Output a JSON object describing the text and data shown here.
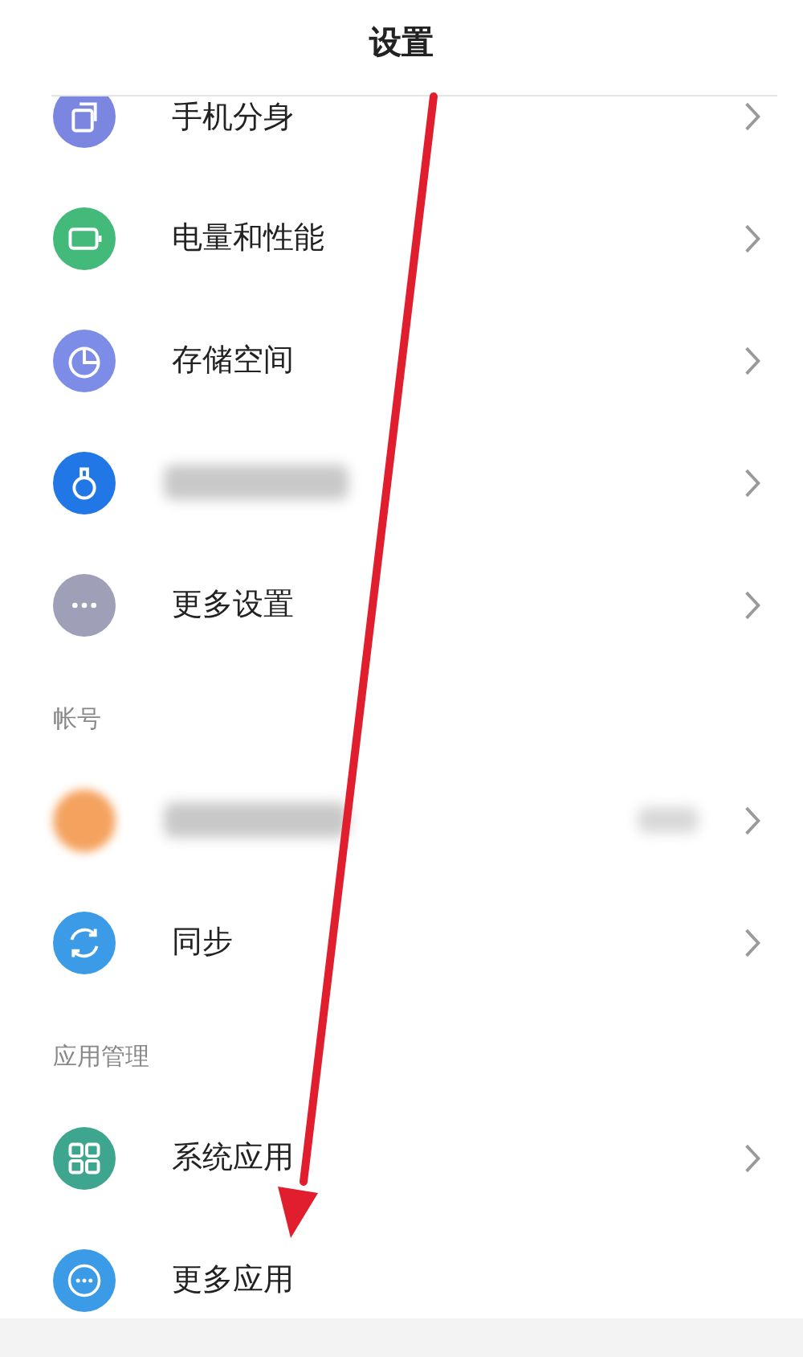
{
  "header": {
    "title": "设置"
  },
  "sections": [
    {
      "items": [
        {
          "kind": "clone",
          "color": "#7b86e0",
          "label": "手机分身",
          "chevron": true
        },
        {
          "kind": "battery",
          "color": "#43b97a",
          "label": "电量和性能",
          "chevron": true
        },
        {
          "kind": "storage",
          "color": "#7d8ce6",
          "label": "存储空间",
          "chevron": true
        },
        {
          "kind": "bottle",
          "color": "#2277e6",
          "blurred": true,
          "chevron": true
        },
        {
          "kind": "dots",
          "color": "#9fa0b8",
          "label": "更多设置",
          "chevron": true
        }
      ]
    },
    {
      "title": "帐号",
      "items": [
        {
          "kind": "avatar",
          "color": "#f4a25e",
          "blurred": true,
          "blurred_value": true,
          "chevron": true
        },
        {
          "kind": "sync",
          "color": "#3b9be6",
          "label": "同步",
          "chevron": true
        }
      ]
    },
    {
      "title": "应用管理",
      "items": [
        {
          "kind": "grid",
          "color": "#3ea58e",
          "label": "系统应用",
          "chevron": true
        },
        {
          "kind": "dots-ring",
          "color": "#3b9be6",
          "label": "更多应用",
          "chevron": false
        }
      ]
    }
  ],
  "annotation": {
    "kind": "arrow",
    "color": "#e01e2d"
  }
}
